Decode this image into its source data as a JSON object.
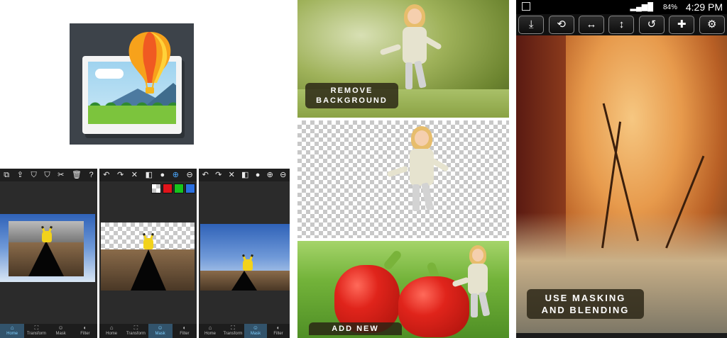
{
  "app_icon": {
    "name": "photo-balloon-icon"
  },
  "editor_screens": [
    {
      "toolbar": [
        "⧉",
        "⇪",
        "⛉",
        "⛉",
        "✂",
        "🗑",
        "?"
      ],
      "nav": [
        {
          "label": "Home",
          "icon": "⌂",
          "active": true
        },
        {
          "label": "Transform",
          "icon": "⛶",
          "active": false
        },
        {
          "label": "Mask",
          "icon": "☺",
          "active": false
        },
        {
          "label": "Filter",
          "icon": "◐",
          "active": false
        }
      ]
    },
    {
      "toolbar": [
        "↶",
        "↷",
        "✕",
        "◧",
        "●",
        "⊕",
        "⊖"
      ],
      "swatches": [
        "#cccccc",
        "#e0141b",
        "#17c31d",
        "#2a6fe0"
      ],
      "nav": [
        {
          "label": "Home",
          "icon": "⌂",
          "active": false
        },
        {
          "label": "Transform",
          "icon": "⛶",
          "active": false
        },
        {
          "label": "Mask",
          "icon": "☺",
          "active": true
        },
        {
          "label": "Filter",
          "icon": "◐",
          "active": false
        }
      ]
    },
    {
      "toolbar": [
        "↶",
        "↷",
        "✕",
        "◧",
        "●",
        "⊕",
        "⊖"
      ],
      "nav": [
        {
          "label": "Home",
          "icon": "⌂",
          "active": false
        },
        {
          "label": "Transform",
          "icon": "⛶",
          "active": false
        },
        {
          "label": "Mask",
          "icon": "☺",
          "active": true
        },
        {
          "label": "Filter",
          "icon": "◐",
          "active": false
        }
      ]
    }
  ],
  "feature_panels": {
    "remove_background": "REMOVE\nBACKGROUND",
    "add_new": "ADD NEW"
  },
  "right_phone": {
    "status": {
      "signal": "▂▄▆█",
      "battery": "84%",
      "time": "4:29 PM"
    },
    "tools": [
      {
        "name": "save-icon",
        "glyph": "⤓"
      },
      {
        "name": "rotate-swap-icon",
        "glyph": "⟲"
      },
      {
        "name": "flip-horizontal-icon",
        "glyph": "↔"
      },
      {
        "name": "flip-vertical-icon",
        "glyph": "↕"
      },
      {
        "name": "rotate-icon",
        "glyph": "↺"
      },
      {
        "name": "add-icon",
        "glyph": "✚"
      },
      {
        "name": "settings-icon",
        "glyph": "⚙"
      }
    ],
    "caption": "USE MASKING\nAND BLENDING"
  },
  "colors": {
    "brand_dark": "#3d434a",
    "nav_active": "#32536b"
  }
}
